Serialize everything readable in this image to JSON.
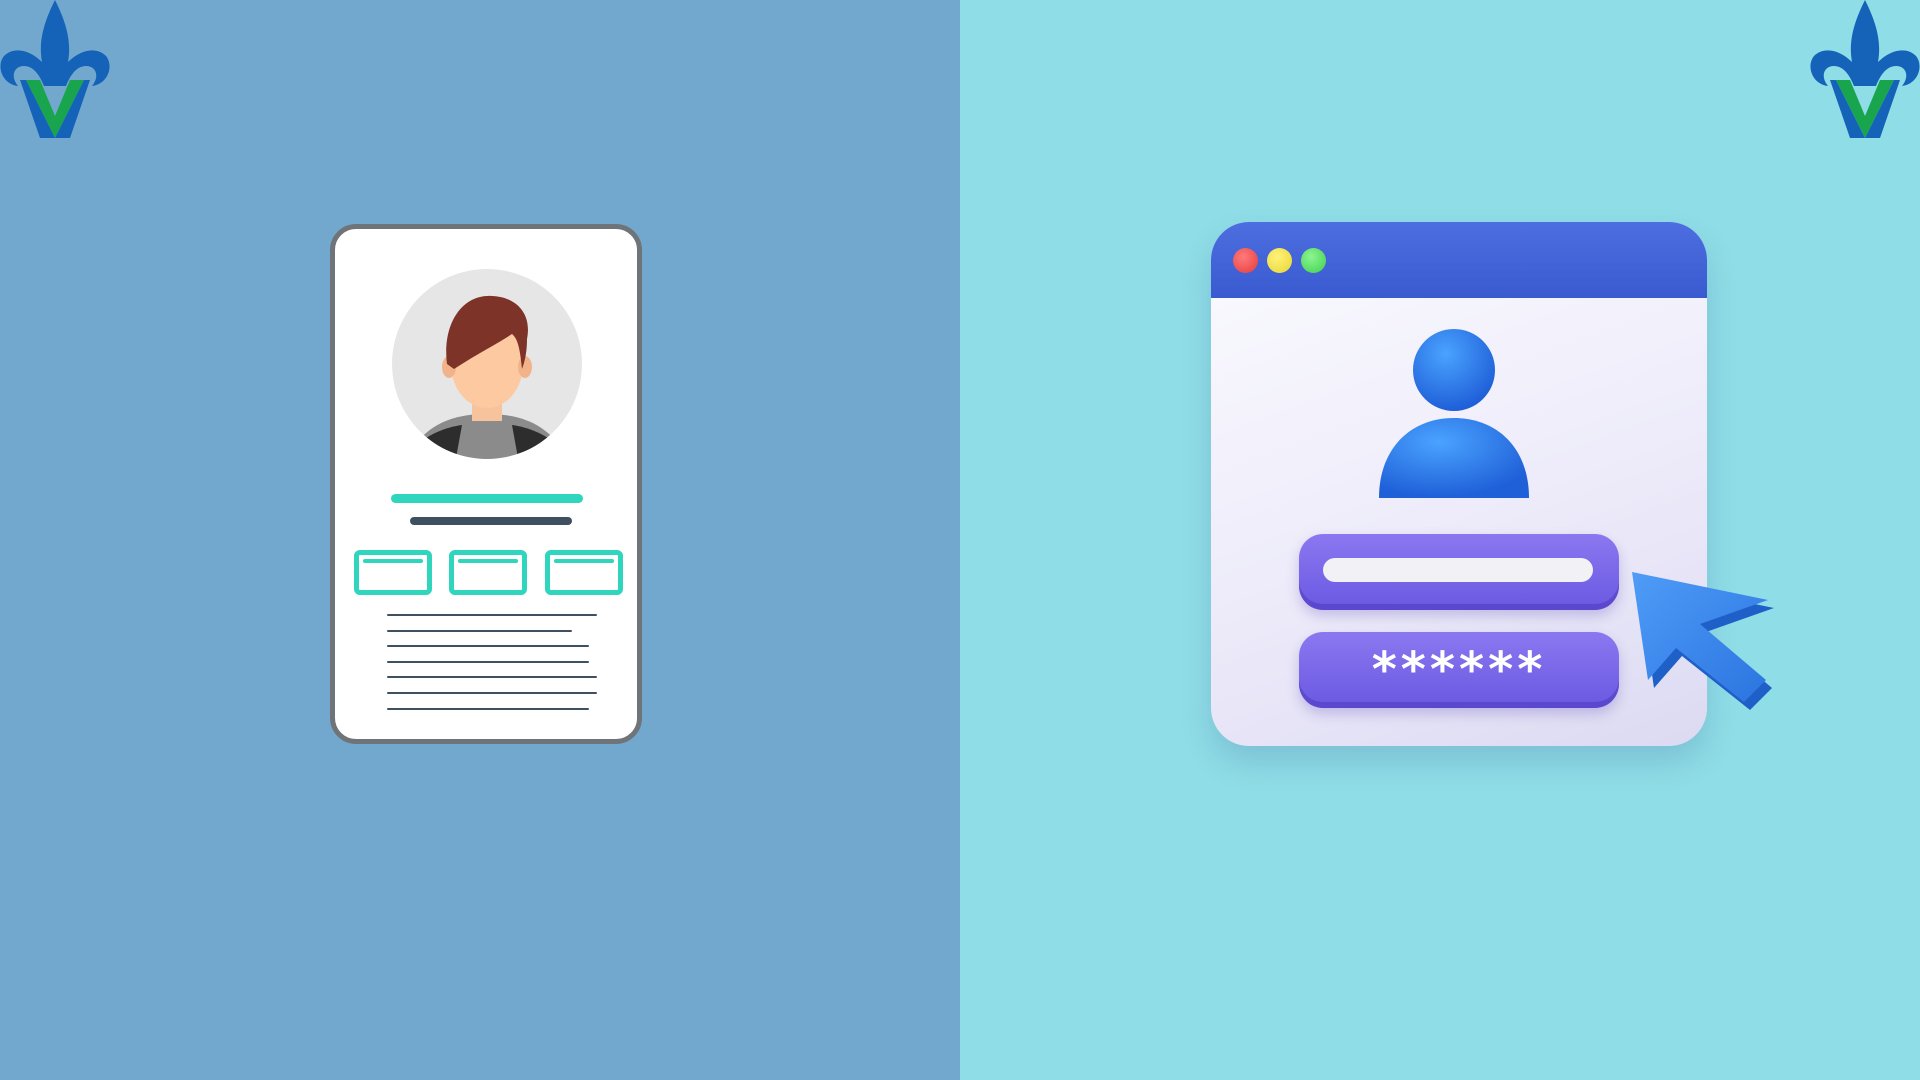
{
  "colors": {
    "left_background": "#72a8cd",
    "right_background": "#8fdde6",
    "name_bar": "#2fd5bd",
    "subtitle_bar": "#3f5160",
    "window_titlebar": "#4465d8",
    "traffic_red": "#e63b3b",
    "traffic_yellow": "#e8d532",
    "traffic_green": "#3fcf4e",
    "field_purple": "#7563e8",
    "user_icon_blue": "#2a7be8",
    "cursor_blue": "#3b8cf0",
    "logo_blue": "#1463b8",
    "logo_green": "#18a54e"
  },
  "left_panel": {
    "logo": {
      "icon": "fleur-de-lis-v-logo-icon"
    },
    "profile_card": {
      "avatar_icon": "person-avatar-icon",
      "info_box_count": 3,
      "text_line_count": 7
    }
  },
  "right_panel": {
    "logo": {
      "icon": "fleur-de-lis-v-logo-icon"
    },
    "login_window": {
      "traffic_lights": [
        "red",
        "yellow",
        "green"
      ],
      "user_icon": "user-icon",
      "username_field": "",
      "password_mask": "******",
      "cursor_icon": "cursor-arrow-icon"
    }
  }
}
